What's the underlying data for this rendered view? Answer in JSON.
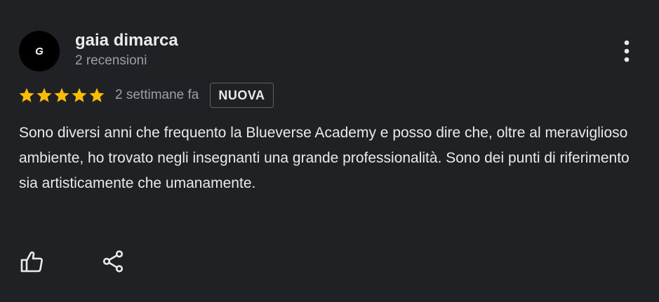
{
  "review": {
    "author": {
      "avatar_initial": "G",
      "name": "gaia dimarca",
      "meta": "2 recensioni"
    },
    "rating": 5,
    "rating_max": 5,
    "date": "2 settimane fa",
    "badge": "NUOVA",
    "text": "Sono diversi anni che frequento la Blueverse Academy e posso dire che, oltre al meraviglioso ambiente, ho trovato negli insegnanti una grande professionalità. Sono dei punti di riferimento sia artisticamente che umanamente."
  },
  "icons": {
    "more": "more-vert-icon",
    "star": "star-icon",
    "like": "thumb-up-icon",
    "share": "share-icon"
  },
  "colors": {
    "background": "#202124",
    "star": "#fbbc04",
    "text_primary": "#e8eaed",
    "text_secondary": "#9aa0a6",
    "badge_border": "#5f6368"
  }
}
